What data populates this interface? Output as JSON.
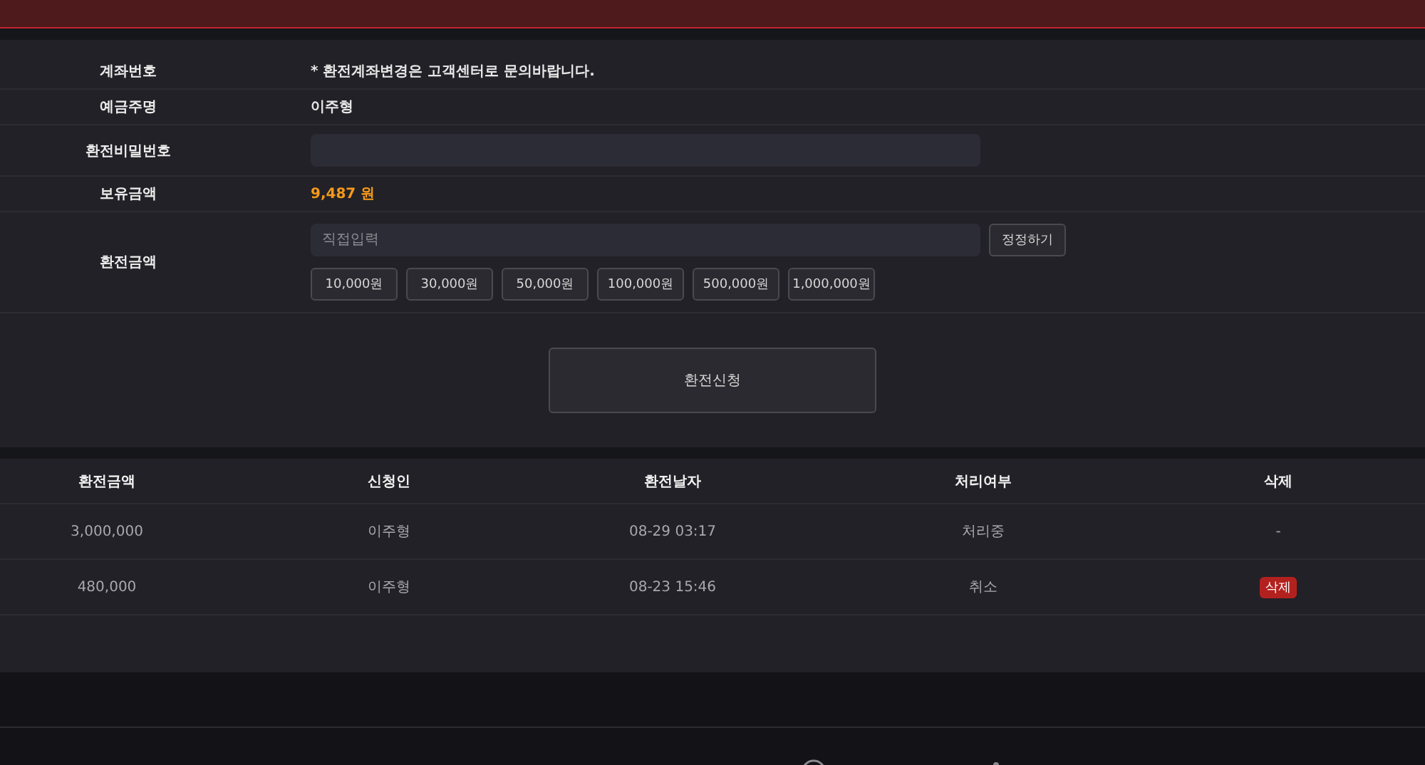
{
  "form": {
    "rows": [
      {
        "kind": "text",
        "label": "계좌번호",
        "value": "* 환전계좌변경은 고객센터로 문의바랍니다."
      },
      {
        "kind": "text",
        "label": "예금주명",
        "value": "이주형"
      },
      {
        "kind": "password",
        "label": "환전비밀번호"
      },
      {
        "kind": "amount",
        "label": "보유금액",
        "value": "9,487 원"
      },
      {
        "kind": "input",
        "label": "환전금액",
        "placeholder": "직접입력",
        "reset": "정정하기",
        "presets": [
          "10,000원",
          "30,000원",
          "50,000원",
          "100,000원",
          "500,000원",
          "1,000,000원"
        ]
      }
    ],
    "submit": "환전신청"
  },
  "history": {
    "columns": [
      "환전금액",
      "신청인",
      "환전날자",
      "처리여부",
      "삭제"
    ],
    "rows": [
      {
        "amount": "3,000,000",
        "name": "이주형",
        "date": "08-29 03:17",
        "status": "처리중",
        "delete": {
          "kind": "text",
          "label": "-"
        }
      },
      {
        "amount": "480,000",
        "name": "이주형",
        "date": "08-23 15:46",
        "status": "취소",
        "delete": {
          "kind": "button",
          "label": "삭제"
        }
      }
    ]
  }
}
